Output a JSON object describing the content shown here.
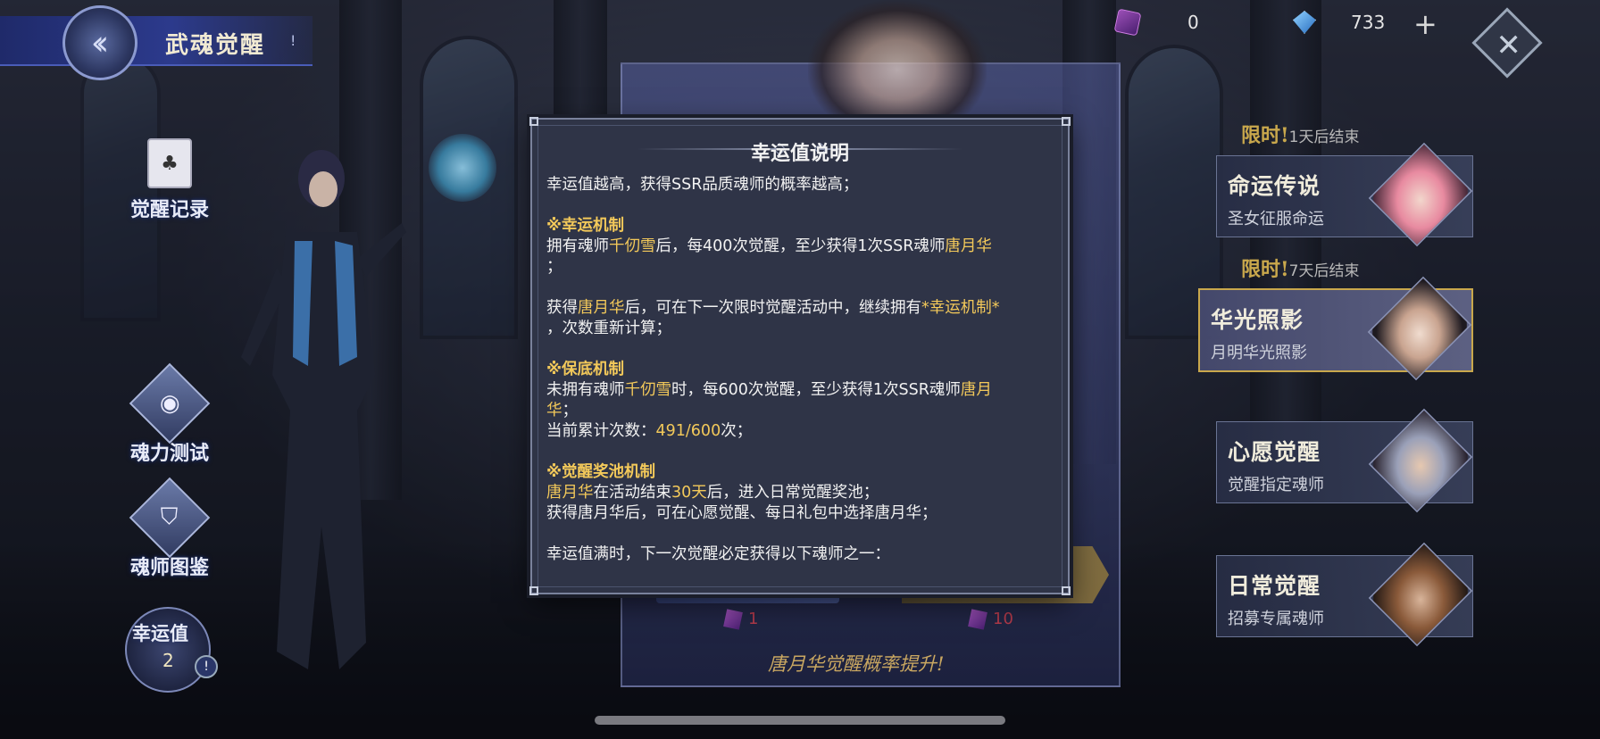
{
  "header": {
    "title": "武魂觉醒",
    "info_icon": "info-icon",
    "back_icon": "back-chevron-icon"
  },
  "resources": {
    "ticket_count": "0",
    "diamond_count": "733",
    "plus_label": "+",
    "close_label": "✕"
  },
  "side_menu": {
    "record_label": "觉醒记录",
    "soul_test_label": "魂力测试",
    "codex_label": "魂师图鉴",
    "luck_label": "幸运值",
    "luck_value": "2",
    "luck_alert": "!"
  },
  "events": {
    "limit_word": "限时!",
    "items": [
      {
        "limit_suffix": "1天后结束",
        "title": "命运传说",
        "subtitle": "圣女征服命运"
      },
      {
        "limit_suffix": "7天后结束",
        "title": "华光照影",
        "subtitle": "月明华光照影"
      },
      {
        "title": "心愿觉醒",
        "subtitle": "觉醒指定魂师"
      },
      {
        "title": "日常觉醒",
        "subtitle": "招募专属魂师"
      }
    ]
  },
  "banner": {
    "cost_single": "1",
    "cost_ten": "10",
    "tagline": "唐月华觉醒概率提升!"
  },
  "modal": {
    "title": "幸运值说明",
    "lines": {
      "l1": "幸运值越高，获得SSR品质魂师的概率越高；",
      "sec1": "※幸运机制",
      "l2a": "拥有魂师",
      "l2b": "千仞雪",
      "l2c": "后，每400次觉醒，至少获得1次SSR魂师",
      "l2d": "唐月华",
      "l3": "；",
      "l4a": "获得",
      "l4b": "唐月华",
      "l4c": "后，可在下一次限时觉醒活动中，继续拥有",
      "l4d": "*幸运机制*",
      "l5": "，次数重新计算；",
      "sec2": "※保底机制",
      "l6a": "未拥有魂师",
      "l6b": "千仞雪",
      "l6c": "时，每600次觉醒，至少获得1次SSR魂师",
      "l6d": "唐月",
      "l7a": "华",
      "l7b": "；",
      "l8a": "当前累计次数：",
      "l8b": "491/600",
      "l8c": "次；",
      "sec3": "※觉醒奖池机制",
      "l9a": "唐月华",
      "l9b": "在活动结束",
      "l9c": "30天",
      "l9d": "后，进入日常觉醒奖池；",
      "l10": "获得唐月华后，可在心愿觉醒、每日礼包中选择唐月华；",
      "l11": "幸运值满时，下一次觉醒必定获得以下魂师之一："
    }
  },
  "colors": {
    "highlight": "#f3c95a",
    "modal_bg": "#2f3447",
    "title_bar": "#2c3a8c",
    "gold_accent": "#c9a84c"
  }
}
